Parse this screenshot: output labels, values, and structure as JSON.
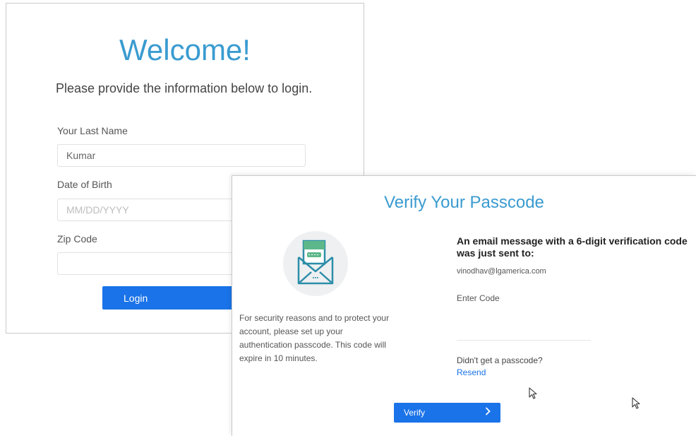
{
  "login": {
    "title": "Welcome!",
    "subtitle": "Please provide the information below to login.",
    "fields": [
      {
        "label": "Your Last Name",
        "value": "Kumar",
        "placeholder": ""
      },
      {
        "label": "Date of Birth",
        "value": "",
        "placeholder": "MM/DD/YYYY"
      },
      {
        "label": "Zip Code",
        "value": "",
        "placeholder": ""
      }
    ],
    "button_label": "Login"
  },
  "verify": {
    "title": "Verify Your Passcode",
    "icon": "envelope-passcode-icon",
    "security_text": "For security reasons and to protect your account, please set up your authentication passcode. This code will expire in 10 minutes.",
    "email_heading": "An email message with a 6-digit verification code was just sent to:",
    "email_address": "vinodhav@lgamerica.com",
    "code_label": "Enter Code",
    "code_value": "",
    "no_code_text": "Didn't get a passcode?",
    "resend_label": "Resend",
    "button_label": "Verify",
    "button_icon": "chevron-right-icon"
  },
  "colors": {
    "accent": "#1a73e8",
    "title": "#3a9bd0",
    "icon_green": "#5cb88a",
    "icon_teal": "#2c8ea8"
  }
}
